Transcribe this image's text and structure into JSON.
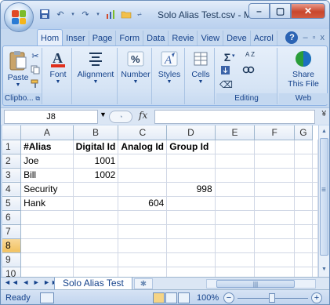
{
  "window": {
    "title": "Solo Alias Test.csv - M...",
    "buttons": {
      "minimize": "–",
      "maximize": "▢",
      "close": "✕"
    }
  },
  "quick_access": {
    "save_icon": "save-icon",
    "undo_icon": "undo-icon",
    "redo_icon": "redo-icon"
  },
  "ribbon_tabs": [
    "Hom",
    "Inser",
    "Page",
    "Form",
    "Data",
    "Revie",
    "View",
    "Deve",
    "Acrol"
  ],
  "ribbon_controls": {
    "help": "?",
    "minimize": "–",
    "restore": "▫",
    "close": "x"
  },
  "ribbon": {
    "clipboard": {
      "paste": "Paste",
      "label": "Clipbo..."
    },
    "font": {
      "label": "Font"
    },
    "alignment": {
      "label": "Alignment"
    },
    "number": {
      "label": "Number",
      "symbol": "%"
    },
    "styles": {
      "label": "Styles"
    },
    "cells": {
      "label": "Cells"
    },
    "editing": {
      "label": "Editing",
      "sum": "Σ",
      "sort": "A Z"
    },
    "webex": {
      "share": "Share",
      "this_file": "This File",
      "label": "Web"
    }
  },
  "formula_bar": {
    "name_box": "J8",
    "fx": "fx",
    "value": ""
  },
  "grid": {
    "columns": [
      "A",
      "B",
      "C",
      "D",
      "E",
      "F",
      "G"
    ],
    "rows": [
      {
        "n": "1",
        "cells": [
          "#Alias",
          "Digital Id",
          "Analog Id",
          "Group Id",
          "",
          "",
          ""
        ]
      },
      {
        "n": "2",
        "cells": [
          "Joe",
          "1001",
          "",
          "",
          "",
          "",
          ""
        ]
      },
      {
        "n": "3",
        "cells": [
          "Bill",
          "1002",
          "",
          "",
          "",
          "",
          ""
        ]
      },
      {
        "n": "4",
        "cells": [
          "Security",
          "",
          "",
          "998",
          "",
          "",
          ""
        ]
      },
      {
        "n": "5",
        "cells": [
          "Hank",
          "",
          "604",
          "",
          "",
          "",
          ""
        ]
      },
      {
        "n": "6",
        "cells": [
          "",
          "",
          "",
          "",
          "",
          "",
          ""
        ]
      },
      {
        "n": "7",
        "cells": [
          "",
          "",
          "",
          "",
          "",
          "",
          ""
        ]
      },
      {
        "n": "8",
        "cells": [
          "",
          "",
          "",
          "",
          "",
          "",
          ""
        ]
      },
      {
        "n": "9",
        "cells": [
          "",
          "",
          "",
          "",
          "",
          "",
          ""
        ]
      },
      {
        "n": "10",
        "cells": [
          "",
          "",
          "",
          "",
          "",
          "",
          ""
        ]
      }
    ],
    "selected_row": "8"
  },
  "sheet_tabs": {
    "nav": "◄◄ ◄ ► ►►",
    "active": "Solo Alias Test"
  },
  "status_bar": {
    "ready": "Ready",
    "zoom": "100%",
    "zoom_minus": "−",
    "zoom_plus": "+"
  },
  "colors": {
    "accent": "#15428b",
    "selection": "#f1c15f",
    "close": "#c9472d"
  }
}
